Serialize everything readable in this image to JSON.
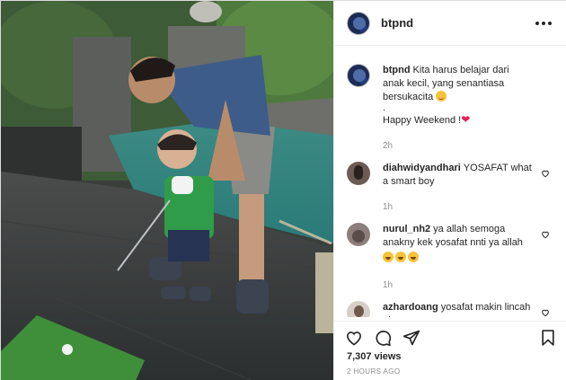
{
  "post": {
    "username": "btpnd",
    "caption": {
      "line1": "Kita harus belajar dari anak kecil, yang senantiasa bersukacita",
      "dot": ".",
      "line2": "Happy Weekend !",
      "time": "2h"
    },
    "comments": [
      {
        "username": "diahwidyandhari",
        "text": "YOSAFAT what a smart boy",
        "time": "1h"
      },
      {
        "username": "nurul_nh2",
        "text": "ya allah semoga anakny kek yosafat nnti ya allah",
        "time": "1h"
      },
      {
        "username": "azhardoang",
        "text": "yosafat makin lincah aja",
        "time": ""
      }
    ],
    "views": "7,307 views",
    "date": "2 HOURS AGO"
  },
  "icons": {
    "more": "more-horizontal-icon",
    "like": "heart-outline-icon",
    "comment": "comment-bubble-icon",
    "share": "paper-plane-icon",
    "save": "bookmark-icon",
    "comment_like": "small-heart-icon"
  },
  "colors": {
    "text": "#262626",
    "muted": "#8e8e8e",
    "border": "#dbdbdb",
    "heart": "#e0245e"
  }
}
